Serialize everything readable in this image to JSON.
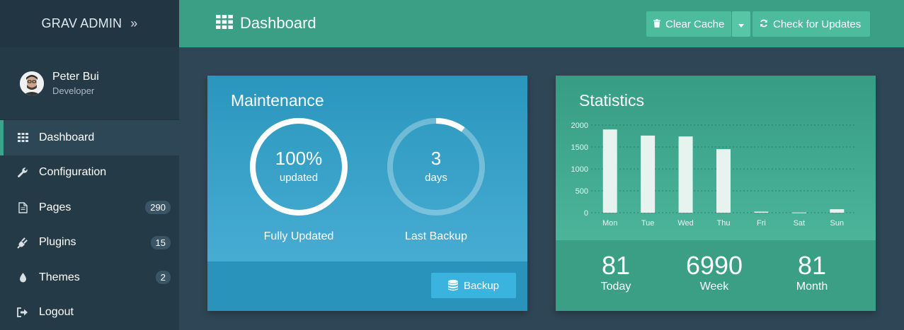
{
  "brand": {
    "title": "GRAV ADMIN",
    "collapse_icon": "double-chevron-right-icon"
  },
  "user": {
    "name": "Peter Bui",
    "role": "Developer"
  },
  "sidebar": {
    "items": [
      {
        "label": "Dashboard",
        "icon": "grid-icon",
        "active": true
      },
      {
        "label": "Configuration",
        "icon": "wrench-icon"
      },
      {
        "label": "Pages",
        "icon": "file-icon",
        "badge": "290"
      },
      {
        "label": "Plugins",
        "icon": "plug-icon",
        "badge": "15"
      },
      {
        "label": "Themes",
        "icon": "drop-icon",
        "badge": "2"
      },
      {
        "label": "Logout",
        "icon": "sign-out-icon"
      }
    ]
  },
  "header": {
    "title": "Dashboard",
    "clear_cache_label": "Clear Cache",
    "check_updates_label": "Check for Updates"
  },
  "maintenance": {
    "title": "Maintenance",
    "updated_value": "100%",
    "updated_unit": "updated",
    "updated_caption": "Fully Updated",
    "updated_fraction": 1.0,
    "backup_value": "3",
    "backup_unit": "days",
    "backup_caption": "Last Backup",
    "backup_fraction": 0.1,
    "backup_button": "Backup"
  },
  "statistics": {
    "title": "Statistics",
    "today_value": "81",
    "today_label": "Today",
    "week_value": "6990",
    "week_label": "Week",
    "month_value": "81",
    "month_label": "Month"
  },
  "colors": {
    "accent": "#3aa58a",
    "header": "#3a9f85",
    "sidebar": "#253a47",
    "maintenance": "#2a96bd",
    "stats": "#369d84"
  },
  "chart_data": {
    "type": "bar",
    "categories": [
      "Mon",
      "Tue",
      "Wed",
      "Thu",
      "Fri",
      "Sat",
      "Sun"
    ],
    "values": [
      1900,
      1760,
      1740,
      1450,
      25,
      5,
      80
    ],
    "y_ticks": [
      "2000",
      "1500",
      "1000",
      "500",
      "0"
    ],
    "ylim": [
      0,
      2000
    ],
    "grid": true
  }
}
